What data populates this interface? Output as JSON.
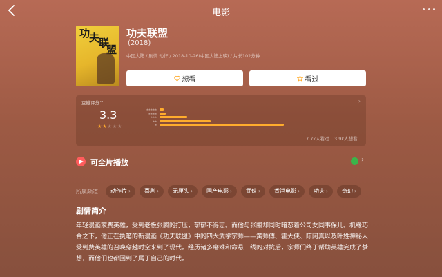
{
  "nav": {
    "title": "电影",
    "back_icon": "chevron-left-icon",
    "more_icon": "more-icon"
  },
  "movie": {
    "poster_chars": [
      "功",
      "夫",
      "联",
      "盟"
    ],
    "title": "功夫联盟",
    "year": "(2018)",
    "meta": "中国大陆 / 剧情 动作 / 2018-10-26(中国大陆上映) / 片长102分钟"
  },
  "actions": {
    "want": "想看",
    "seen": "看过"
  },
  "rating": {
    "label": "豆瓣评分™",
    "score": "3.3",
    "stars": 1.5,
    "distribution": [
      {
        "stars": "★★★★★",
        "percent": 2
      },
      {
        "stars": "★★★★",
        "percent": 3
      },
      {
        "stars": "★★★",
        "percent": 13
      },
      {
        "stars": "★★",
        "percent": 24
      },
      {
        "stars": "★",
        "percent": 58
      }
    ],
    "watched": "7.7k人看过",
    "wish": "3.9k人想看"
  },
  "playback": {
    "label": "可全片播放"
  },
  "genres": {
    "label": "所属频道",
    "tags": [
      "动作片",
      "喜剧",
      "无厘头",
      "国产电影",
      "武侠",
      "香港电影",
      "功夫",
      "奇幻"
    ]
  },
  "summary": {
    "title": "剧情简介",
    "lines": [
      "年轻漫画家费英雄，受到老板张鹏的打压，郁郁不得志。而他与张鹏却同时暗恋着公司女同事保儿。机缘巧合之下，他正在执笔的新漫画《功夫联盟》中的四大武学宗师——黄师傅、霍大侠、陈阿真以及叶姓神秘人受到费英雄的召唤穿越时空来到了现代。经历诸多磨难和命悬一线的对抗后，宗师们终于帮助英雄完成了梦想，而他们也都回到了属于自己的时代。"
    ]
  },
  "colors": {
    "accent": "#ffac2d",
    "play": "#ff5c5c"
  }
}
